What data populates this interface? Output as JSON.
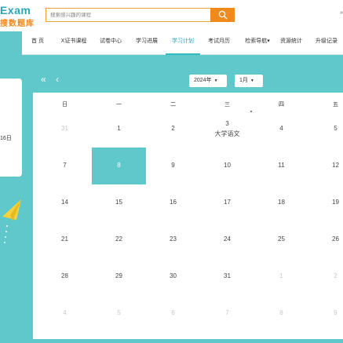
{
  "header": {
    "logo_en": "Exam",
    "logo_cn": "搜数题库",
    "search_placeholder": "搜索感兴趣的课程",
    "right_text": "»"
  },
  "nav": {
    "items": [
      {
        "label": "首 页"
      },
      {
        "label": "X证书课程"
      },
      {
        "label": "试卷中心"
      },
      {
        "label": "学习进展"
      },
      {
        "label": "学习计划",
        "active": true
      },
      {
        "label": "考试月历"
      },
      {
        "label": "检索导航▾"
      },
      {
        "label": "资源统计"
      },
      {
        "label": "升级记录"
      }
    ]
  },
  "left_panel": {
    "date_fragment": "16日"
  },
  "calendar": {
    "prev_year": "«",
    "prev_month": "‹",
    "year": "2024年",
    "month": "1月",
    "weekdays": [
      "日",
      "一",
      "二",
      "三",
      "四",
      "五"
    ],
    "weeks": [
      [
        {
          "d": "31",
          "o": true
        },
        {
          "d": "1"
        },
        {
          "d": "2"
        },
        {
          "d": "3",
          "e": "大学语文"
        },
        {
          "d": "4"
        },
        {
          "d": "5"
        }
      ],
      [
        {
          "d": "7"
        },
        {
          "d": "8",
          "t": true
        },
        {
          "d": "9"
        },
        {
          "d": "10"
        },
        {
          "d": "11"
        },
        {
          "d": "12"
        }
      ],
      [
        {
          "d": "14"
        },
        {
          "d": "15"
        },
        {
          "d": "16"
        },
        {
          "d": "17"
        },
        {
          "d": "18"
        },
        {
          "d": "19"
        }
      ],
      [
        {
          "d": "21"
        },
        {
          "d": "22"
        },
        {
          "d": "23"
        },
        {
          "d": "24"
        },
        {
          "d": "25"
        },
        {
          "d": "26"
        }
      ],
      [
        {
          "d": "28"
        },
        {
          "d": "29"
        },
        {
          "d": "30"
        },
        {
          "d": "31"
        },
        {
          "d": "1",
          "o": true
        },
        {
          "d": "2",
          "o": true
        }
      ],
      [
        {
          "d": "4",
          "o": true
        },
        {
          "d": "5",
          "o": true
        },
        {
          "d": "6",
          "o": true
        },
        {
          "d": "7",
          "o": true
        },
        {
          "d": "8",
          "o": true
        },
        {
          "d": "9",
          "o": true
        }
      ]
    ]
  },
  "colors": {
    "teal": "#5fc8cb",
    "orange": "#f08a1c"
  }
}
